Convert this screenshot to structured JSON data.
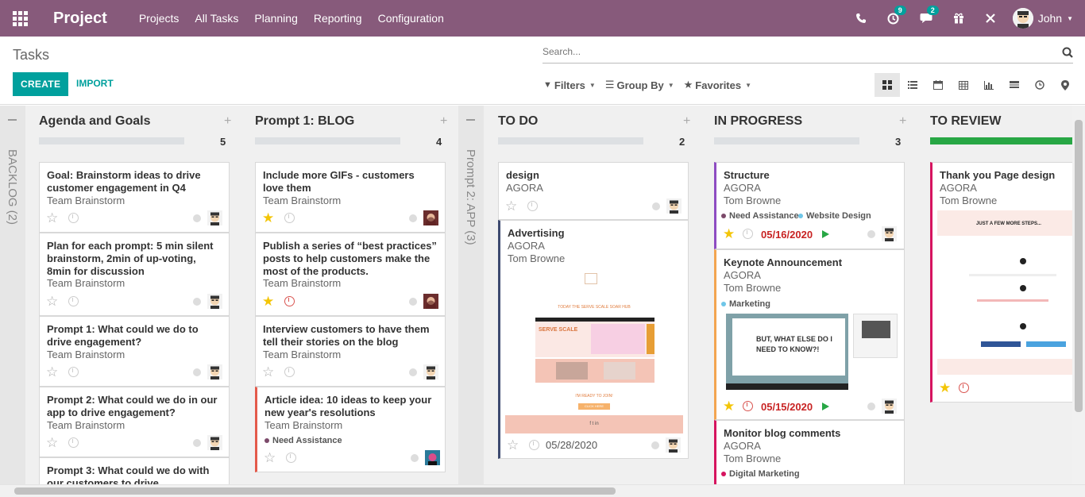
{
  "navbar": {
    "brand": "Project",
    "menu": [
      "Projects",
      "All Tasks",
      "Planning",
      "Reporting",
      "Configuration"
    ],
    "activity_count": "9",
    "message_count": "2",
    "user": "John"
  },
  "control": {
    "breadcrumb": "Tasks",
    "search_placeholder": "Search...",
    "create_label": "CREATE",
    "import_label": "IMPORT",
    "filters_label": "Filters",
    "groupby_label": "Group By",
    "favorites_label": "Favorites"
  },
  "folded": {
    "backlog": "BACKLOG (2)",
    "prompt2": "Prompt 2: APP (3)"
  },
  "columns": {
    "agenda": {
      "title": "Agenda and Goals",
      "count": "5",
      "cards": [
        {
          "title": "Goal: Brainstorm ideas to drive customer engagement in Q4",
          "sub": "Team Brainstorm"
        },
        {
          "title": "Plan for each prompt: 5 min silent brainstorm, 2min of up-voting, 8min for discussion",
          "sub": "Team Brainstorm"
        },
        {
          "title": "Prompt 1: What could we do to drive engagement?",
          "sub": "Team Brainstorm"
        },
        {
          "title": "Prompt 2: What could we do in our app to drive engagement?",
          "sub": "Team Brainstorm"
        },
        {
          "title": "Prompt 3: What could we do with our customers to drive"
        }
      ]
    },
    "blog": {
      "title": "Prompt 1: BLOG",
      "count": "4",
      "cards": [
        {
          "title": "Include more GIFs - customers love them",
          "sub": "Team Brainstorm"
        },
        {
          "title": "Publish a series of “best practices” posts to help customers make the most of the products.",
          "sub": "Team Brainstorm"
        },
        {
          "title": "Interview customers to have them tell their stories on the blog",
          "sub": "Team Brainstorm"
        },
        {
          "title": "Article idea: 10 ideas to keep your new year's resolutions",
          "sub": "Team Brainstorm",
          "tag": "Need Assistance"
        }
      ]
    },
    "todo": {
      "title": "TO DO",
      "count": "2",
      "cards": [
        {
          "title": "design",
          "sub": "AGORA"
        },
        {
          "title": "Advertising",
          "sub": "AGORA",
          "sub2": "Tom Browne",
          "date": "05/28/2020",
          "image": {
            "banner": "TODAY THE SERVE SCALE SOAR HUB",
            "headline": "SERVE SCALE",
            "cta": "I'M READY TO JOIN!",
            "button": "CLICK HERE",
            "footer": "f t in"
          }
        }
      ]
    },
    "inprogress": {
      "title": "IN PROGRESS",
      "count": "3",
      "cards": [
        {
          "title": "Structure",
          "sub": "AGORA",
          "sub2": "Tom Browne",
          "tag1": "Need Assistance",
          "tag2": "Website Design",
          "date": "05/16/2020"
        },
        {
          "title": "Keynote Announcement",
          "sub": "AGORA",
          "sub2": "Tom Browne",
          "tag": "Marketing",
          "date": "05/15/2020",
          "image": {
            "text": "BUT, WHAT ELSE DO I NEED TO KNOW?!"
          }
        },
        {
          "title": "Monitor blog comments",
          "sub": "AGORA",
          "sub2": "Tom Browne",
          "tag": "Digital Marketing"
        }
      ]
    },
    "review": {
      "title": "TO REVIEW",
      "cards": [
        {
          "title": "Thank you Page design",
          "sub": "AGORA",
          "sub2": "Tom Browne",
          "image": {
            "heading": "JUST A FEW MORE STEPS..."
          }
        }
      ]
    }
  },
  "colors": {
    "navbar": "#875a7b",
    "primary": "#00a09d",
    "tag_need_assistance": "#7c4a6a",
    "tag_website": "#6fc6e8",
    "tag_marketing": "#6fc6e8",
    "tag_digital": "#d6145f",
    "date_red": "#c82323"
  }
}
